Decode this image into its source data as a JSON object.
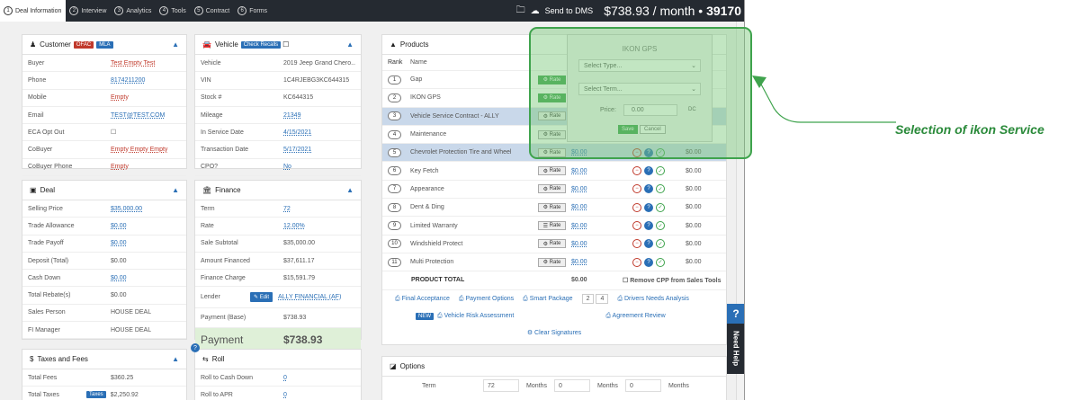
{
  "topbar": {
    "steps": [
      {
        "num": "1",
        "label": "Deal Information"
      },
      {
        "num": "2",
        "label": "Interview"
      },
      {
        "num": "3",
        "label": "Analytics"
      },
      {
        "num": "4",
        "label": "Tools"
      },
      {
        "num": "5",
        "label": "Contract"
      },
      {
        "num": "6",
        "label": "Forms"
      }
    ],
    "send_label": "Send to DMS",
    "price": "$738.93 / month •",
    "deal_number": "39170"
  },
  "customer": {
    "title": "Customer",
    "badge1": "OFAC",
    "badge2": "MLA",
    "rows": [
      {
        "k": "Buyer",
        "v": "Test Empty Test"
      },
      {
        "k": "Phone",
        "v": "8174211200"
      },
      {
        "k": "Mobile",
        "v": "Empty"
      },
      {
        "k": "Email",
        "v": "TEST@TEST.COM"
      },
      {
        "k": "ECA Opt Out",
        "v": "☐"
      },
      {
        "k": "CoBuyer",
        "v": "Empty Empty Empty"
      },
      {
        "k": "CoBuyer Phone",
        "v": "Empty"
      }
    ]
  },
  "vehicle": {
    "title": "Vehicle",
    "badge": "Check Recalls",
    "rows": [
      {
        "k": "Vehicle",
        "v": "2019 Jeep Grand Chero..."
      },
      {
        "k": "VIN",
        "v": "1C4RJEBG3KC644315"
      },
      {
        "k": "Stock #",
        "v": "KC644315"
      },
      {
        "k": "Mileage",
        "v": "21349"
      },
      {
        "k": "In Service Date",
        "v": "4/15/2021"
      },
      {
        "k": "Transaction Date",
        "v": "5/17/2021"
      },
      {
        "k": "CPO?",
        "v": "No"
      }
    ]
  },
  "deal": {
    "title": "Deal",
    "rows": [
      {
        "k": "Selling Price",
        "v": "$35,000.00"
      },
      {
        "k": "Trade Allowance",
        "v": "$0.00"
      },
      {
        "k": "Trade Payoff",
        "v": "$0.00"
      },
      {
        "k": "Deposit (Total)",
        "v": "$0.00"
      },
      {
        "k": "Cash Down",
        "v": "$0.00"
      },
      {
        "k": "Total Rebate(s)",
        "v": "$0.00"
      },
      {
        "k": "Sales Person",
        "v": "HOUSE DEAL"
      },
      {
        "k": "FI Manager",
        "v": "HOUSE DEAL"
      }
    ]
  },
  "finance": {
    "title": "Finance",
    "rows": [
      {
        "k": "Term",
        "v": "72"
      },
      {
        "k": "Rate",
        "v": "12.00%"
      },
      {
        "k": "Sale Subtotal",
        "v": "$35,000.00"
      },
      {
        "k": "Amount Financed",
        "v": "$37,611.17"
      },
      {
        "k": "Finance Charge",
        "v": "$15,591.79"
      },
      {
        "k": "Lender",
        "v": "ALLY FINANCIAL (AF)"
      },
      {
        "k": "Payment (Base)",
        "v": "$738.93"
      }
    ],
    "edit_label": "Edit",
    "payment_label": "Payment",
    "payment_value": "$738.93"
  },
  "taxes": {
    "title": "Taxes and Fees",
    "rows": [
      {
        "k": "Total Fees",
        "v": "$360.25"
      },
      {
        "k": "Total Taxes",
        "v": "$2,250.92"
      }
    ],
    "taxes_badge": "Taxes"
  },
  "roll": {
    "title": "Roll",
    "rows": [
      {
        "k": "Roll to Cash Down",
        "v": "0"
      },
      {
        "k": "Roll to APR",
        "v": "0"
      }
    ]
  },
  "products": {
    "title": "Products",
    "col_rank": "Rank",
    "col_name": "Name",
    "items": [
      {
        "rank": "1",
        "name": "Gap",
        "rate": "Rate",
        "amt": "",
        "price": ""
      },
      {
        "rank": "2",
        "name": "IKON GPS",
        "rate": "Rate",
        "amt": "",
        "price": ""
      },
      {
        "rank": "3",
        "name": "Vehicle Service Contract - ALLY",
        "rate": "Rate",
        "amt": "",
        "price": ""
      },
      {
        "rank": "4",
        "name": "Maintenance",
        "rate": "Rate",
        "amt": "",
        "price": ""
      },
      {
        "rank": "5",
        "name": "Chevrolet Protection Tire and Wheel",
        "rate": "Rate",
        "amt": "$0.00",
        "price": "$0.00"
      },
      {
        "rank": "6",
        "name": "Key Fetch",
        "rate": "Rate",
        "amt": "$0.00",
        "price": "$0.00"
      },
      {
        "rank": "7",
        "name": "Appearance",
        "rate": "Rate",
        "amt": "$0.00",
        "price": "$0.00"
      },
      {
        "rank": "8",
        "name": "Dent & Ding",
        "rate": "Rate",
        "amt": "$0.00",
        "price": "$0.00"
      },
      {
        "rank": "9",
        "name": "Limited Warranty",
        "rate": "Rate",
        "amt": "$0.00",
        "price": "$0.00"
      },
      {
        "rank": "10",
        "name": "Windshield Protect",
        "rate": "Rate",
        "amt": "$0.00",
        "price": "$0.00"
      },
      {
        "rank": "11",
        "name": "Multi Protection",
        "rate": "Rate",
        "amt": "$0.00",
        "price": "$0.00"
      }
    ],
    "total_label": "PRODUCT TOTAL",
    "total_value": "$0.00",
    "remove_cpp": "Remove CPP from Sales Tools",
    "links": {
      "final": "Final Acceptance",
      "payment_options": "Payment Options",
      "smart_package": "Smart Package",
      "sp1": "2",
      "sp2": "4",
      "drivers": "Drivers Needs Analysis",
      "new_badge": "NEW",
      "risk": "Vehicle Risk Assessment",
      "agreement": "Agreement Review",
      "clear": "Clear Signatures"
    }
  },
  "options": {
    "title": "Options",
    "term_label": "Term",
    "term_value": "72",
    "months": "Months",
    "v2": "0",
    "v3": "0"
  },
  "popup": {
    "title": "IKON GPS",
    "type_placeholder": "Select Type...",
    "term_placeholder": "Select Term...",
    "price_label": "Price:",
    "price_value": "0.00",
    "dc": "DC",
    "save": "Save",
    "cancel": "Cancel"
  },
  "annotation": "Selection of ikon Service",
  "help": {
    "label": "Need Help",
    "q": "?"
  },
  "colors": {
    "accent": "#2a6fb6",
    "green": "#3fa34d",
    "dark": "#252a31",
    "red": "#c0392b"
  }
}
